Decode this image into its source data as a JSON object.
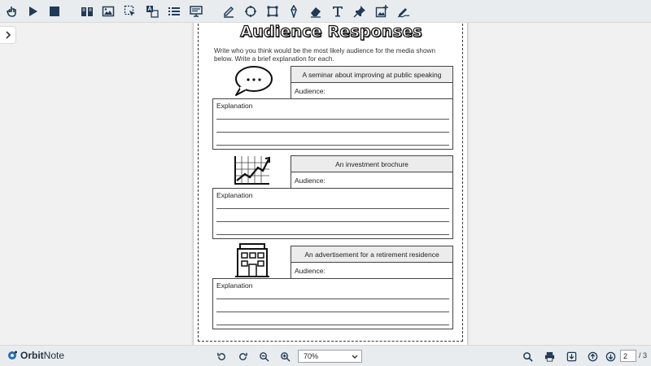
{
  "toolbar": {
    "icons": [
      "hand-pointer-icon",
      "play-icon",
      "stop-icon",
      "book-icon",
      "image-icon",
      "select-icon",
      "translate-icon",
      "list-icon",
      "presentation-icon",
      "pen-icon",
      "move-icon",
      "crop-icon",
      "pencil-icon",
      "eraser-icon",
      "text-icon",
      "pin-icon",
      "add-image-icon",
      "signature-icon"
    ]
  },
  "worksheet": {
    "title": "Audience Responses",
    "instructions": "Write who you think would be the most likely audience for the media shown below. Write a brief explanation for each.",
    "items": [
      {
        "media": "A seminar about improving at public speaking",
        "audience_label": "Audience:",
        "explanation_label": "Explanation",
        "illustration": "speech-bubble-icon"
      },
      {
        "media": "An investment brochure",
        "audience_label": "Audience:",
        "explanation_label": "Explanation",
        "illustration": "chart-growth-icon"
      },
      {
        "media": "An advertisement for a retirement residence",
        "audience_label": "Audience:",
        "explanation_label": "Explanation",
        "illustration": "building-icon"
      }
    ]
  },
  "bottombar": {
    "brand_bold": "Orbit",
    "brand_light": "Note",
    "zoom_value": "70%",
    "page_current": "2",
    "page_total": "/ 3"
  },
  "colors": {
    "toolbar_bg": "#e9ecef",
    "icon": "#1f3b57",
    "brand_blue": "#2b6cb0"
  }
}
